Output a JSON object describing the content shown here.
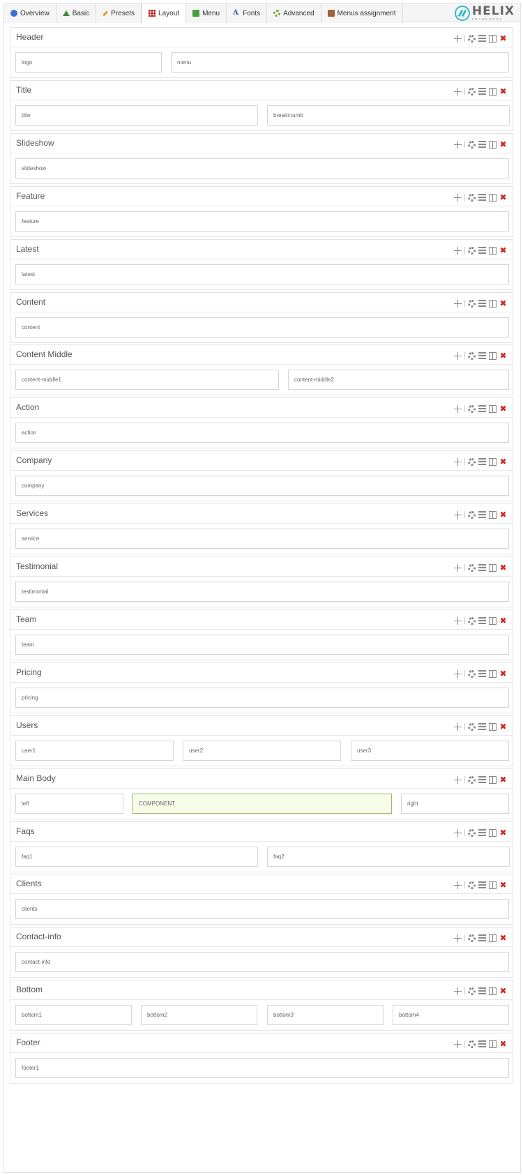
{
  "tabs": [
    {
      "label": "Overview",
      "icon": "info-icon",
      "active": false
    },
    {
      "label": "Basic",
      "icon": "home-icon",
      "active": false
    },
    {
      "label": "Presets",
      "icon": "pencil-icon",
      "active": false
    },
    {
      "label": "Layout",
      "icon": "grid-icon",
      "active": true
    },
    {
      "label": "Menu",
      "icon": "list-icon",
      "active": false
    },
    {
      "label": "Fonts",
      "icon": "font-icon",
      "active": false
    },
    {
      "label": "Advanced",
      "icon": "gear-icon",
      "active": false
    },
    {
      "label": "Menus assignment",
      "icon": "menu-assign-icon",
      "active": false
    }
  ],
  "logo": {
    "name": "HELIX",
    "sub": "FRAMEWORK"
  },
  "colors": {
    "accent": "#35b9c8",
    "component_bg": "#f7fde9",
    "component_border": "#9bb865",
    "delete": "#d0281e"
  },
  "sections": [
    {
      "title": "Header",
      "modules": [
        "logo",
        "menu"
      ]
    },
    {
      "title": "Title",
      "modules": [
        "title",
        "breadcrumb"
      ]
    },
    {
      "title": "Slideshow",
      "modules": [
        "slideshow"
      ]
    },
    {
      "title": "Feature",
      "modules": [
        "feature"
      ]
    },
    {
      "title": "Latest",
      "modules": [
        "latest"
      ]
    },
    {
      "title": "Content",
      "modules": [
        "content"
      ]
    },
    {
      "title": "Content Middle",
      "modules": [
        "content-middle1",
        "content-middle2"
      ]
    },
    {
      "title": "Action",
      "modules": [
        "action"
      ]
    },
    {
      "title": "Company",
      "modules": [
        "company"
      ]
    },
    {
      "title": "Services",
      "modules": [
        "service"
      ]
    },
    {
      "title": "Testimonial",
      "modules": [
        "testimonial"
      ]
    },
    {
      "title": "Team",
      "modules": [
        "team"
      ]
    },
    {
      "title": "Pricing",
      "modules": [
        "pricing"
      ]
    },
    {
      "title": "Users",
      "modules": [
        "user1",
        "user2",
        "user3"
      ]
    },
    {
      "title": "Main Body",
      "modules": [
        "left",
        "COMPONENT",
        "right"
      ]
    },
    {
      "title": "Faqs",
      "modules": [
        "faq1",
        "faq2"
      ]
    },
    {
      "title": "Clients",
      "modules": [
        "clients"
      ]
    },
    {
      "title": "Contact-info",
      "modules": [
        "contact-info"
      ]
    },
    {
      "title": "Bottom",
      "modules": [
        "bottom1",
        "bottom2",
        "bottom3",
        "bottom4"
      ]
    },
    {
      "title": "Footer",
      "modules": [
        "footer1"
      ]
    }
  ]
}
